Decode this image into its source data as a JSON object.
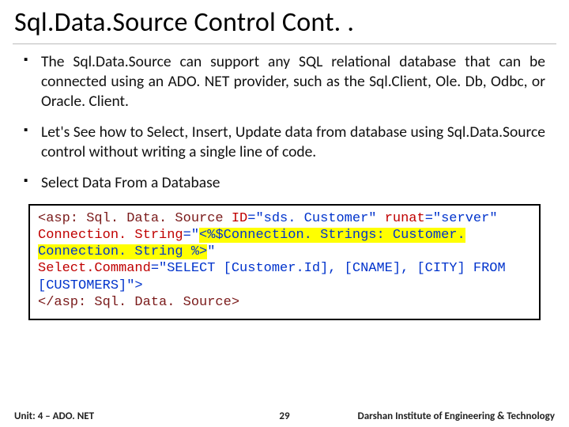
{
  "title": "Sql.Data.Source Control Cont. .",
  "bullets": [
    "The Sql.Data.Source can support any SQL relational database that can be connected using an ADO. NET provider, such as the Sql.Client, Ole. Db, Odbc, or Oracle. Client.",
    "Let's See how to Select, Insert, Update data from database using Sql.Data.Source control without writing a single line of code.",
    "Select Data From a Database"
  ],
  "code": {
    "open_tag": "<asp: Sql. Data. Source ",
    "attr_id": "ID",
    "val_id": "=\"sds. Customer\" ",
    "attr_runat": "runat",
    "val_runat": "=\"server\"",
    "attr_conn": "Connection. String",
    "val_conn_pre": "=\"",
    "val_conn_hl": "<%$Connection. Strings: Customer. Connection. String %>",
    "val_conn_post": "\"",
    "attr_sel": "Select.Command",
    "val_sel": "=\"SELECT [Customer.Id], [CNAME], [CITY] FROM [CUSTOMERS]\">",
    "close_tag": "</asp: Sql. Data. Source>"
  },
  "footer": {
    "left": "Unit: 4 – ADO. NET",
    "center": "29",
    "right": "Darshan Institute of Engineering & Technology"
  }
}
